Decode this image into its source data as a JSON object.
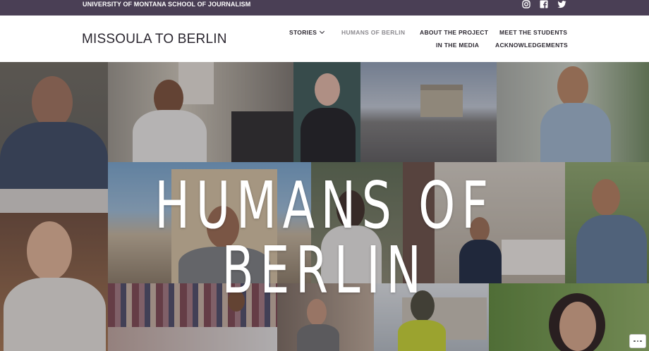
{
  "topbar": {
    "school": "UNIVERSITY OF MONTANA SCHOOL OF JOURNALISM",
    "social": [
      "instagram-icon",
      "facebook-icon",
      "twitter-icon"
    ]
  },
  "header": {
    "site_title": "MISSOULA TO BERLIN",
    "nav": {
      "stories": "STORIES",
      "humans": "HUMANS OF BERLIN",
      "about": "ABOUT THE PROJECT",
      "students": "MEET THE STUDENTS",
      "media": "IN THE MEDIA",
      "ack": "ACKNOWLEDGEMENTS"
    },
    "active_item": "HUMANS OF BERLIN"
  },
  "hero": {
    "title": "HUMANS OF BERLIN",
    "more_button": "more-options-icon"
  },
  "colors": {
    "topbar": "#4a3f55",
    "title_text": "#2b2730",
    "nav_active": "#8c8a8f"
  }
}
